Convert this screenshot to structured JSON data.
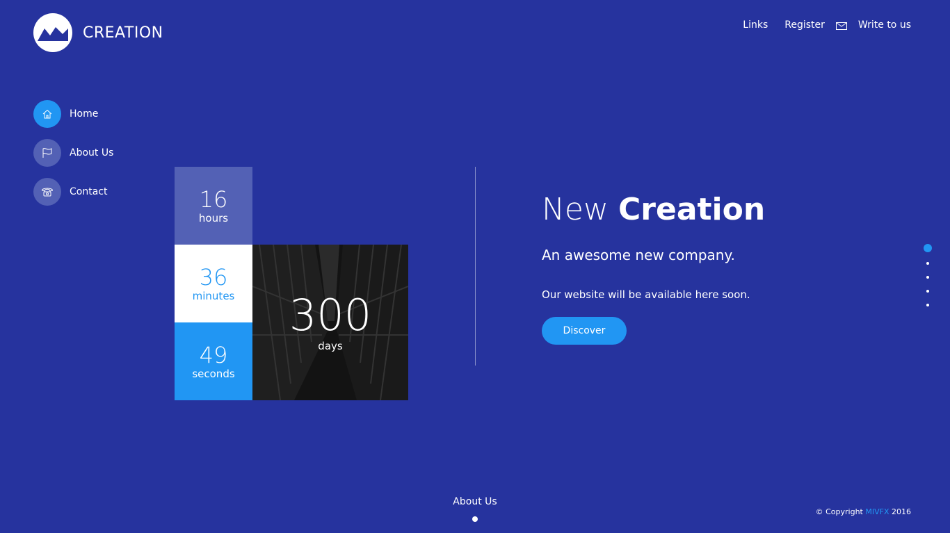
{
  "brand": {
    "name": "CREATION"
  },
  "topnav": {
    "links": "Links",
    "register": "Register",
    "write": "Write to us"
  },
  "sidebar": {
    "items": [
      {
        "label": "Home",
        "icon": "home-icon"
      },
      {
        "label": "About Us",
        "icon": "flag-icon"
      },
      {
        "label": "Contact",
        "icon": "phone-icon"
      }
    ]
  },
  "countdown": {
    "hours": {
      "value": "16",
      "unit": "hours"
    },
    "minutes": {
      "value": "36",
      "unit": "minutes"
    },
    "seconds": {
      "value": "49",
      "unit": "seconds"
    },
    "days": {
      "value": "300",
      "unit": "days"
    }
  },
  "hero": {
    "title_light": "New",
    "title_bold": "Creation",
    "subtitle": "An awesome new company.",
    "description": "Our website will be available here soon.",
    "button": "Discover"
  },
  "footer": {
    "scroll_label": "About Us",
    "copyright_prefix": "© Copyright",
    "copyright_brand": "MIVFX",
    "copyright_year": "2016"
  },
  "colors": {
    "background": "#26339e",
    "accent": "#2196f3",
    "muted_tile": "#5361b5"
  }
}
